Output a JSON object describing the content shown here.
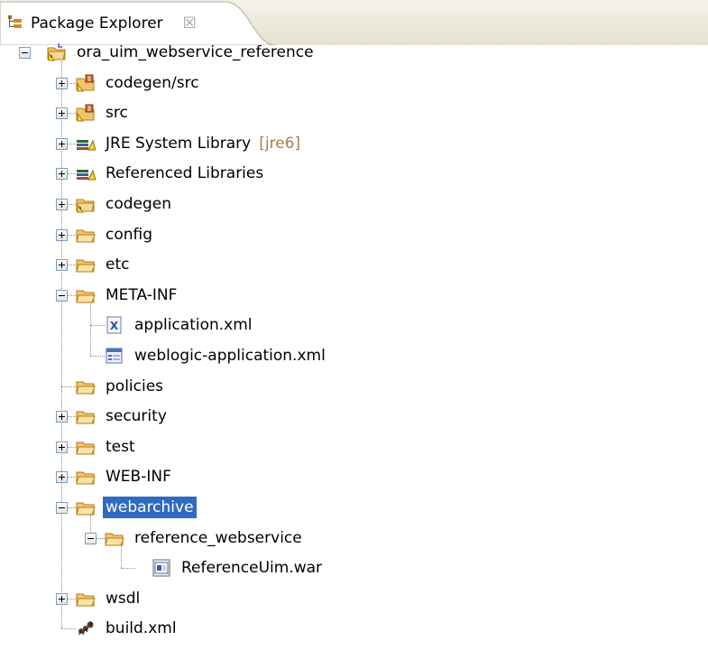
{
  "view": {
    "title": "Package Explorer",
    "close_glyph": "☒",
    "tab_icon": "package-explorer-icon"
  },
  "tree": {
    "root": {
      "label": "ora_uim_webservice_reference",
      "icon": "java-project-icon",
      "expanded": true
    },
    "items": [
      {
        "label": "codegen/src",
        "icon": "source-folder-icon",
        "toggle": "plus"
      },
      {
        "label": "src",
        "icon": "source-folder-icon",
        "toggle": "plus"
      },
      {
        "label": "JRE System Library",
        "decoration": "[jre6]",
        "icon": "library-icon",
        "toggle": "plus"
      },
      {
        "label": "Referenced Libraries",
        "icon": "library-icon",
        "toggle": "plus"
      },
      {
        "label": "codegen",
        "icon": "warning-folder-icon",
        "toggle": "plus"
      },
      {
        "label": "config",
        "icon": "folder-icon",
        "toggle": "plus"
      },
      {
        "label": "etc",
        "icon": "folder-icon",
        "toggle": "plus"
      },
      {
        "label": "META-INF",
        "icon": "folder-icon",
        "toggle": "minus"
      },
      {
        "label": "application.xml",
        "icon": "xml-file-icon",
        "toggle": "none",
        "depth": 2
      },
      {
        "label": "weblogic-application.xml",
        "icon": "descriptor-file-icon",
        "toggle": "none",
        "depth": 2
      },
      {
        "label": "policies",
        "icon": "folder-icon",
        "toggle": "none"
      },
      {
        "label": "security",
        "icon": "folder-icon",
        "toggle": "plus"
      },
      {
        "label": "test",
        "icon": "folder-icon",
        "toggle": "plus"
      },
      {
        "label": "WEB-INF",
        "icon": "folder-icon",
        "toggle": "plus"
      },
      {
        "label": "webarchive",
        "icon": "folder-icon",
        "toggle": "minus",
        "selected": true
      },
      {
        "label": "reference_webservice",
        "icon": "folder-icon",
        "toggle": "minus",
        "depth": 2
      },
      {
        "label": "ReferenceUim.war",
        "icon": "war-file-icon",
        "toggle": "none",
        "depth": 3
      },
      {
        "label": "wsdl",
        "icon": "folder-icon",
        "toggle": "plus"
      },
      {
        "label": "build.xml",
        "icon": "ant-file-icon",
        "toggle": "none"
      }
    ]
  },
  "colors": {
    "selection": "#316ac5",
    "decoration": "#a0824a",
    "tab_background": "#ece9d8"
  }
}
